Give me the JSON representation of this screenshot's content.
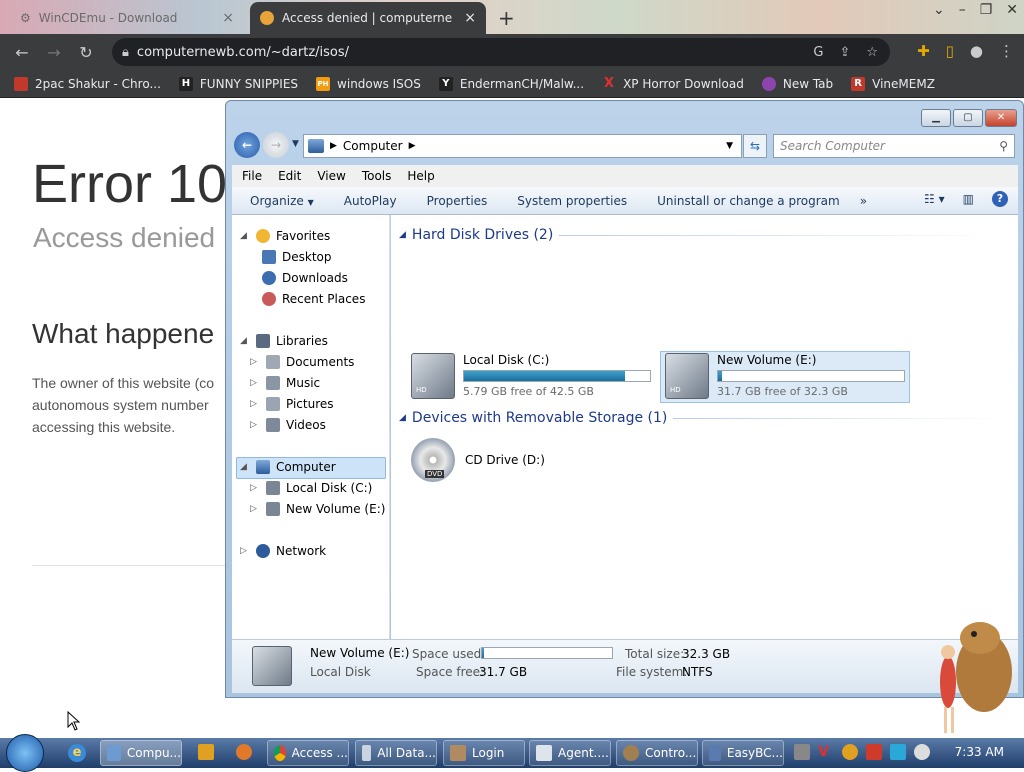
{
  "browser": {
    "tabs": [
      {
        "title": "WinCDEmu - Download",
        "close": "×"
      },
      {
        "title": "Access denied | computernewb.c",
        "close": "×"
      }
    ],
    "new_tab": "+",
    "url": "computernewb.com/~dartz/isos/",
    "bookmarks": [
      {
        "label": "2pac Shakur - Chro...",
        "icon_color": "#c0392b",
        "icon_text": ""
      },
      {
        "label": "FUNNY SNIPPIES",
        "icon_color": "#222",
        "icon_text": "H"
      },
      {
        "label": "windows ISOS",
        "icon_color": "#f39c12",
        "icon_text": "PH"
      },
      {
        "label": "EndermanCH/Malw...",
        "icon_color": "#222",
        "icon_text": "Y"
      },
      {
        "label": "XP Horror Download",
        "icon_color": "#3b3c3e",
        "icon_text": "X"
      },
      {
        "label": "New Tab",
        "icon_color": "#8e44ad",
        "icon_text": ""
      },
      {
        "label": "VineMEMZ",
        "icon_color": "#c0392b",
        "icon_text": "R"
      }
    ]
  },
  "webpage": {
    "error_title": "Error 10",
    "error_subtitle": "Access denied",
    "what_heading": "What happene",
    "paragraph": "The owner of this website (co autonomous system number accessing this website."
  },
  "explorer": {
    "address_crumb": "Computer",
    "search_placeholder": "Search Computer",
    "menu": [
      "File",
      "Edit",
      "View",
      "Tools",
      "Help"
    ],
    "commands": [
      "Organize",
      "AutoPlay",
      "Properties",
      "System properties",
      "Uninstall or change a program",
      "»"
    ],
    "nav": {
      "favorites": "Favorites",
      "desktop": "Desktop",
      "downloads": "Downloads",
      "recent": "Recent Places",
      "libraries": "Libraries",
      "documents": "Documents",
      "music": "Music",
      "pictures": "Pictures",
      "videos": "Videos",
      "computer": "Computer",
      "local_disk": "Local Disk (C:)",
      "new_volume": "New Volume (E:)",
      "network": "Network"
    },
    "groups": {
      "hdd": "Hard Disk Drives (2)",
      "removable": "Devices with Removable Storage (1)"
    },
    "drives": [
      {
        "name": "Local Disk (C:)",
        "free_text": "5.79 GB free of 42.5 GB",
        "used_fraction": 0.864
      },
      {
        "name": "New Volume (E:)",
        "free_text": "31.7 GB free of 32.3 GB",
        "used_fraction": 0.019
      }
    ],
    "cd": "CD Drive (D:)",
    "details": {
      "name": "New Volume (E:)",
      "type": "Local Disk",
      "space_used_label": "Space used:",
      "space_free_label": "Space free:",
      "space_free": "31.7 GB",
      "total_label": "Total size:",
      "total": "32.3 GB",
      "fs_label": "File system:",
      "fs": "NTFS",
      "used_fraction": 0.019
    }
  },
  "taskbar": {
    "items": [
      "Compu...",
      "Access ...",
      "All Data...",
      "Login",
      "Agent....",
      "Contro...",
      "EasyBC..."
    ],
    "clock": "7:33 AM"
  }
}
